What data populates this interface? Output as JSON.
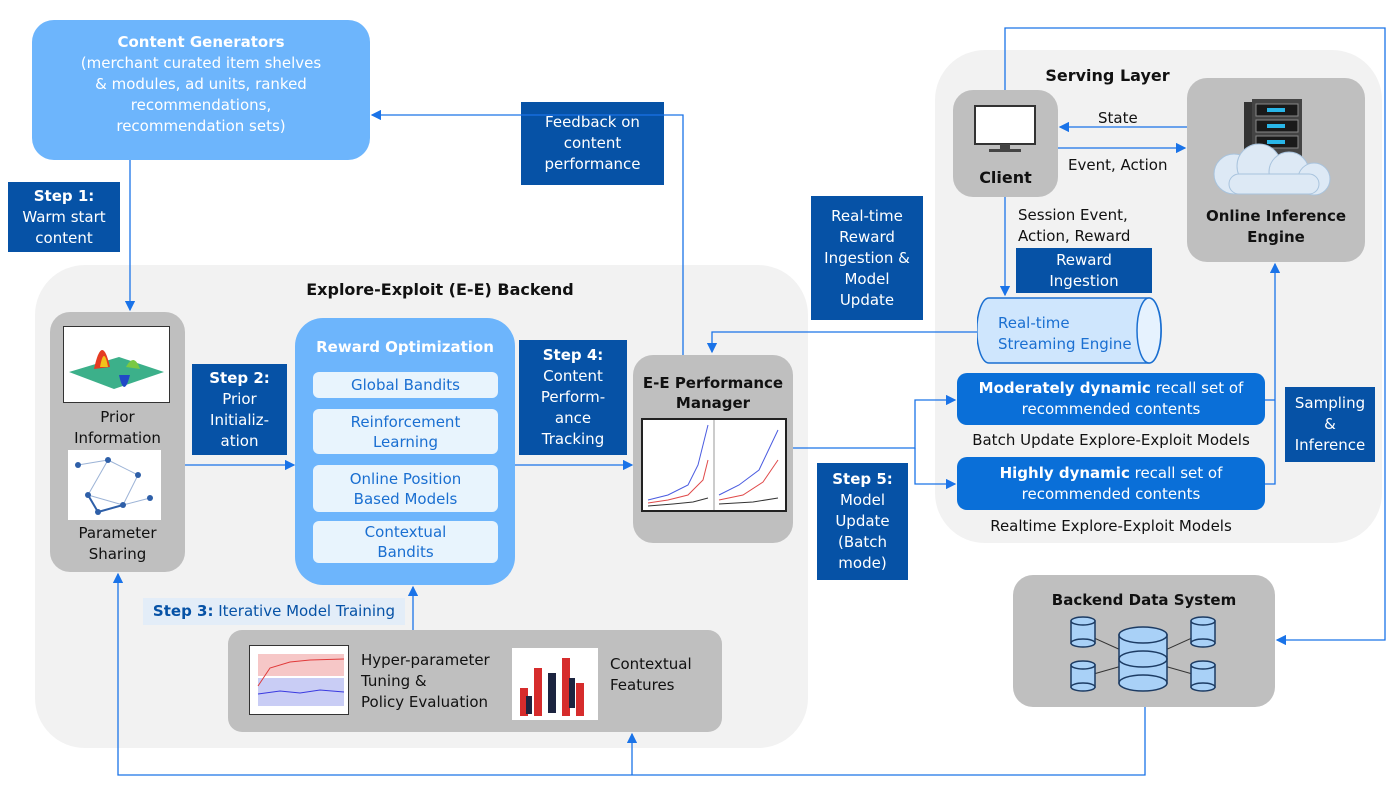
{
  "content_generators": {
    "title": "Content Generators",
    "lines": [
      "(merchant curated item shelves",
      "& modules, ad units, ranked",
      "recommendations,",
      "recommendation sets)"
    ]
  },
  "step1": {
    "title": "Step 1:",
    "text": [
      "Warm start",
      "content"
    ]
  },
  "feedback": {
    "text": [
      "Feedback on",
      "content",
      "performance"
    ]
  },
  "backend": {
    "title": "Explore-Exploit (E-E) Backend",
    "prior": {
      "label1": [
        "Prior",
        "Information"
      ],
      "label2": [
        "Parameter",
        "Sharing"
      ]
    },
    "step2": {
      "title": "Step 2:",
      "text": [
        "Prior",
        "Initializ-",
        "ation"
      ]
    },
    "reward_optimization": {
      "title": "Reward Optimization",
      "items": [
        [
          "Global Bandits"
        ],
        [
          "Reinforcement",
          "Learning"
        ],
        [
          "Online Position",
          "Based Models"
        ],
        [
          "Contextual",
          "Bandits"
        ]
      ]
    },
    "step4": {
      "title": "Step 4:",
      "text": [
        "Content",
        "Perform-",
        "ance",
        "Tracking"
      ]
    },
    "perf_manager": {
      "title": [
        "E-E Performance",
        "Manager"
      ]
    },
    "step3": {
      "title": "Step 3:",
      "text": "Iterative Model Training"
    },
    "training": {
      "hyper": [
        "Hyper-parameter",
        "Tuning &",
        "Policy Evaluation"
      ],
      "contextual": [
        "Contextual",
        "Features"
      ]
    }
  },
  "realtime_reward": {
    "text": [
      "Real-time",
      "Reward",
      "Ingestion &",
      "Model",
      "Update"
    ]
  },
  "step5": {
    "title": "Step 5:",
    "text": [
      "Model",
      "Update",
      "(Batch",
      "mode)"
    ]
  },
  "serving": {
    "title": "Serving Layer",
    "client": "Client",
    "state": "State",
    "event_action": "Event, Action",
    "engine": [
      "Online Inference",
      "Engine"
    ],
    "session": [
      "Session Event,",
      "Action, Reward"
    ],
    "reward_ingestion": [
      "Reward",
      "Ingestion"
    ],
    "streaming": [
      "Real-time",
      "Streaming Engine"
    ],
    "moderate": {
      "bold": "Moderately dynamic",
      "rest": " recall set of",
      "line2": "recommended contents",
      "caption": "Batch Update Explore-Exploit Models"
    },
    "highly": {
      "bold": "Highly dynamic",
      "rest": " recall set of",
      "line2": "recommended contents",
      "caption": "Realtime Explore-Exploit Models"
    },
    "sampling": [
      "Sampling",
      "&",
      "Inference"
    ]
  },
  "backend_data": {
    "title": "Backend Data System"
  },
  "colors": {
    "dark_blue": "#0652a6",
    "light_blue": "#6db5fc",
    "recall_blue": "#0a6fd8",
    "arrow": "#1a73e8",
    "gray": "#bfbfbf",
    "panel": "#f2f2f2"
  }
}
